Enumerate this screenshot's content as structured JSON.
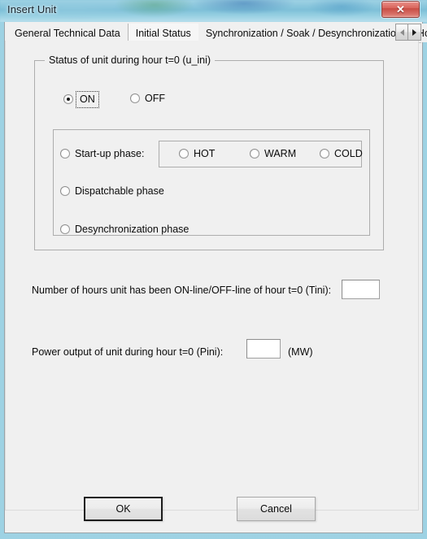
{
  "window": {
    "title": "Insert Unit",
    "close_icon": "close-x-icon",
    "close_label": "✕"
  },
  "tabs": {
    "items": [
      {
        "label": "General Technical Data",
        "active": false
      },
      {
        "label": "Initial Status",
        "active": true
      },
      {
        "label": "Synchronization / Soak / Desynchronization",
        "active": false
      },
      {
        "label": "Hourly Hea",
        "active": false,
        "truncated": true
      }
    ],
    "scroll_left_icon": "triangle-left-icon",
    "scroll_right_icon": "triangle-right-icon"
  },
  "status_group": {
    "legend": "Status of unit during hour t=0 (u_ini)",
    "options": [
      {
        "label": "ON",
        "checked": true,
        "focused": true
      },
      {
        "label": "OFF",
        "checked": false,
        "focused": false
      }
    ]
  },
  "phase_panel": {
    "startup": {
      "label": "Start-up phase:",
      "checked": false,
      "sub_options": [
        {
          "label": "HOT",
          "checked": false
        },
        {
          "label": "WARM",
          "checked": false
        },
        {
          "label": "COLD",
          "checked": false
        }
      ]
    },
    "dispatchable": {
      "label": "Dispatchable phase",
      "checked": false
    },
    "desynchronization": {
      "label": "Desynchronization phase",
      "checked": false
    }
  },
  "fields": {
    "tini": {
      "label": "Number of hours unit has been ON-line/OFF-line of hour t=0 (Tini):",
      "value": "",
      "placeholder": ""
    },
    "pini": {
      "label": "Power output of unit during hour t=0 (Pini):",
      "value": "",
      "placeholder": "",
      "unit": "(MW)"
    }
  },
  "buttons": {
    "ok": "OK",
    "cancel": "Cancel"
  },
  "colors": {
    "glass": "#8fc9dd",
    "dialog_bg": "#f0f0f0",
    "close_red": "#c84c44",
    "text": "#0a0a0a",
    "border": "#adadad"
  }
}
